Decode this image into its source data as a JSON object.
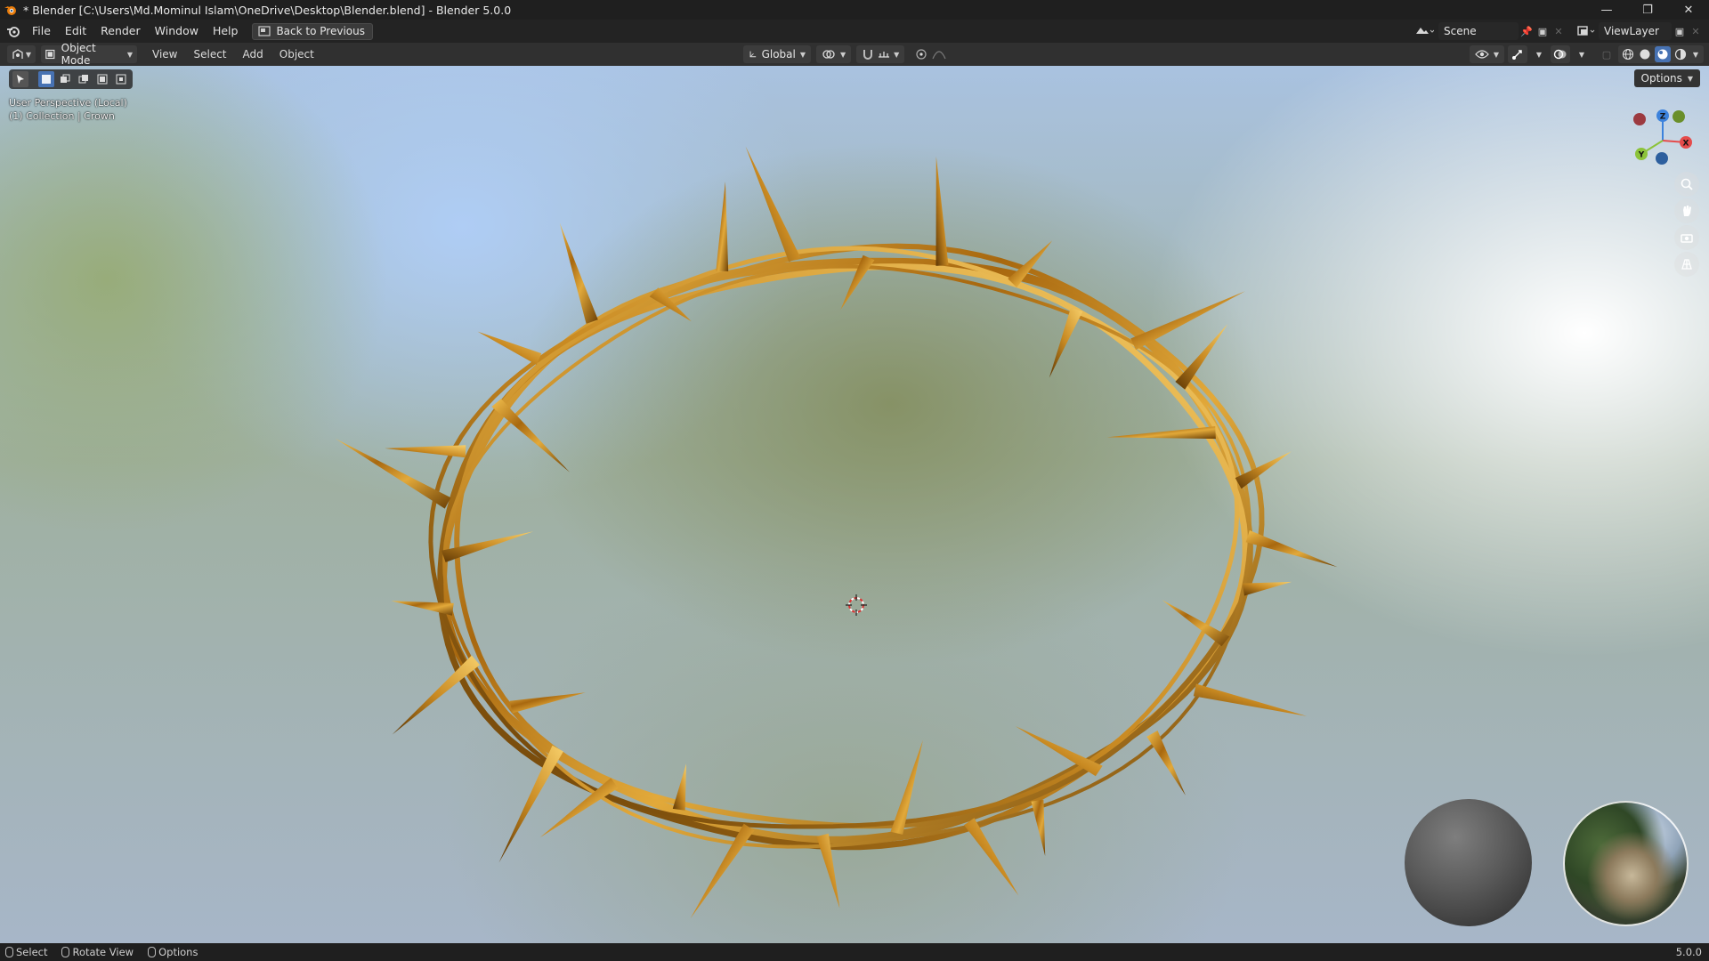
{
  "window": {
    "title": "* Blender [C:\\Users\\Md.Mominul Islam\\OneDrive\\Desktop\\Blender.blend] - Blender 5.0.0",
    "controls": {
      "minimize": "—",
      "maximize": "❐",
      "close": "✕"
    }
  },
  "menubar": {
    "items": [
      "File",
      "Edit",
      "Render",
      "Window",
      "Help"
    ],
    "back_button": "Back to Previous",
    "scene": "Scene",
    "view_layer": "ViewLayer"
  },
  "viewport_header": {
    "mode": "Object Mode",
    "menus": [
      "View",
      "Select",
      "Add",
      "Object"
    ],
    "orientation": "Global"
  },
  "viewport": {
    "perspective": "User Perspective (Local)",
    "collection": "(1) Collection | Crown",
    "options_label": "Options",
    "gizmo": {
      "x_label": "X",
      "y_label": "Y",
      "z_label": "Z",
      "colors": {
        "x": "#e54b4b",
        "y": "#8cc33a",
        "z": "#3c82dc"
      }
    }
  },
  "statusbar": {
    "hints": [
      "Select",
      "Rotate View",
      "Options"
    ],
    "version": "5.0.0"
  },
  "colors": {
    "accent": "#4772b3",
    "crown_gold": "#b07a1c"
  }
}
